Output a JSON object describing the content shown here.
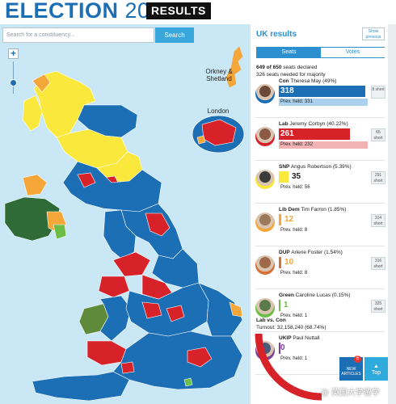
{
  "header": {
    "title_word": "ELECTION",
    "title_year": "2017",
    "badge": "RESULTS"
  },
  "search": {
    "placeholder": "Search for a constituency...",
    "button_label": "Search"
  },
  "map": {
    "zoom_in_label": "+",
    "inset_orkney": "Orkney & Shetland",
    "inset_london": "London",
    "colors": {
      "sea": "#c9e7f4",
      "con": "#1c6fb5",
      "lab": "#d7222a",
      "snp": "#fbe83c",
      "libdem": "#f4a638",
      "dup": "#2e6b36",
      "green": "#6cbd45",
      "sf": "#4a7a3a",
      "pc": "#5e8a3a"
    }
  },
  "panel": {
    "title": "UK results",
    "show_previous": "Show previous",
    "tab_seats": "Seats",
    "tab_votes": "Votes",
    "declared_count": "649 of 650",
    "declared_rest": " seats declared",
    "majority_note": "326 seats needed for majority",
    "prev_prefix": "Prev. held: ",
    "lab_vs_con": "Lab vs. Con",
    "turnout": "Turnout: 32,158,240 (68.74%)"
  },
  "parties": [
    {
      "abbr": "Con",
      "leader": "Theresa May (49%)",
      "seats": "318",
      "prev": "331",
      "short": "8 short",
      "color": "#1c6fb5",
      "text_color": "#ffffff",
      "bar_fraction": 0.975
    },
    {
      "abbr": "Lab",
      "leader": "Jeremy Corbyn (40.22%)",
      "seats": "261",
      "prev": "232",
      "short": "65 short",
      "color": "#d7222a",
      "text_color": "#ffffff",
      "bar_fraction": 0.8
    },
    {
      "abbr": "SNP",
      "leader": "Angus Robertson (5.39%)",
      "seats": "35",
      "prev": "56",
      "short": "291 short",
      "color": "#fbe83c",
      "text_color": "#222222",
      "bar_fraction": 0.11
    },
    {
      "abbr": "Lib Dem",
      "leader": "Tim Farron (1.85%)",
      "seats": "12",
      "prev": "8",
      "short": "314 short",
      "color": "#f4a638",
      "text_color": "#f4a638",
      "bar_fraction": 0.03
    },
    {
      "abbr": "DUP",
      "leader": "Arlene Foster (1.54%)",
      "seats": "10",
      "prev": "8",
      "short": "316 short",
      "color": "#d5703a",
      "text_color": "#f4a638",
      "bar_fraction": 0.03
    },
    {
      "abbr": "Green",
      "leader": "Caroline Lucas (0.15%)",
      "seats": "1",
      "prev": "1",
      "short": "325 short",
      "color": "#6cbd45",
      "text_color": "#6cbd45",
      "bar_fraction": 0.01
    },
    {
      "abbr": "UKIP",
      "leader": "Paul Nuttall",
      "seats": "0",
      "prev": "1",
      "short": "",
      "color": "#7b3f98",
      "text_color": "#7b3f98",
      "bar_fraction": 0.0
    }
  ],
  "footer_buttons": {
    "new_articles_count": "6",
    "new_articles_label": "NEW ARTICLES",
    "top_label": "Top"
  },
  "watermark": "@ 英国大学留学"
}
